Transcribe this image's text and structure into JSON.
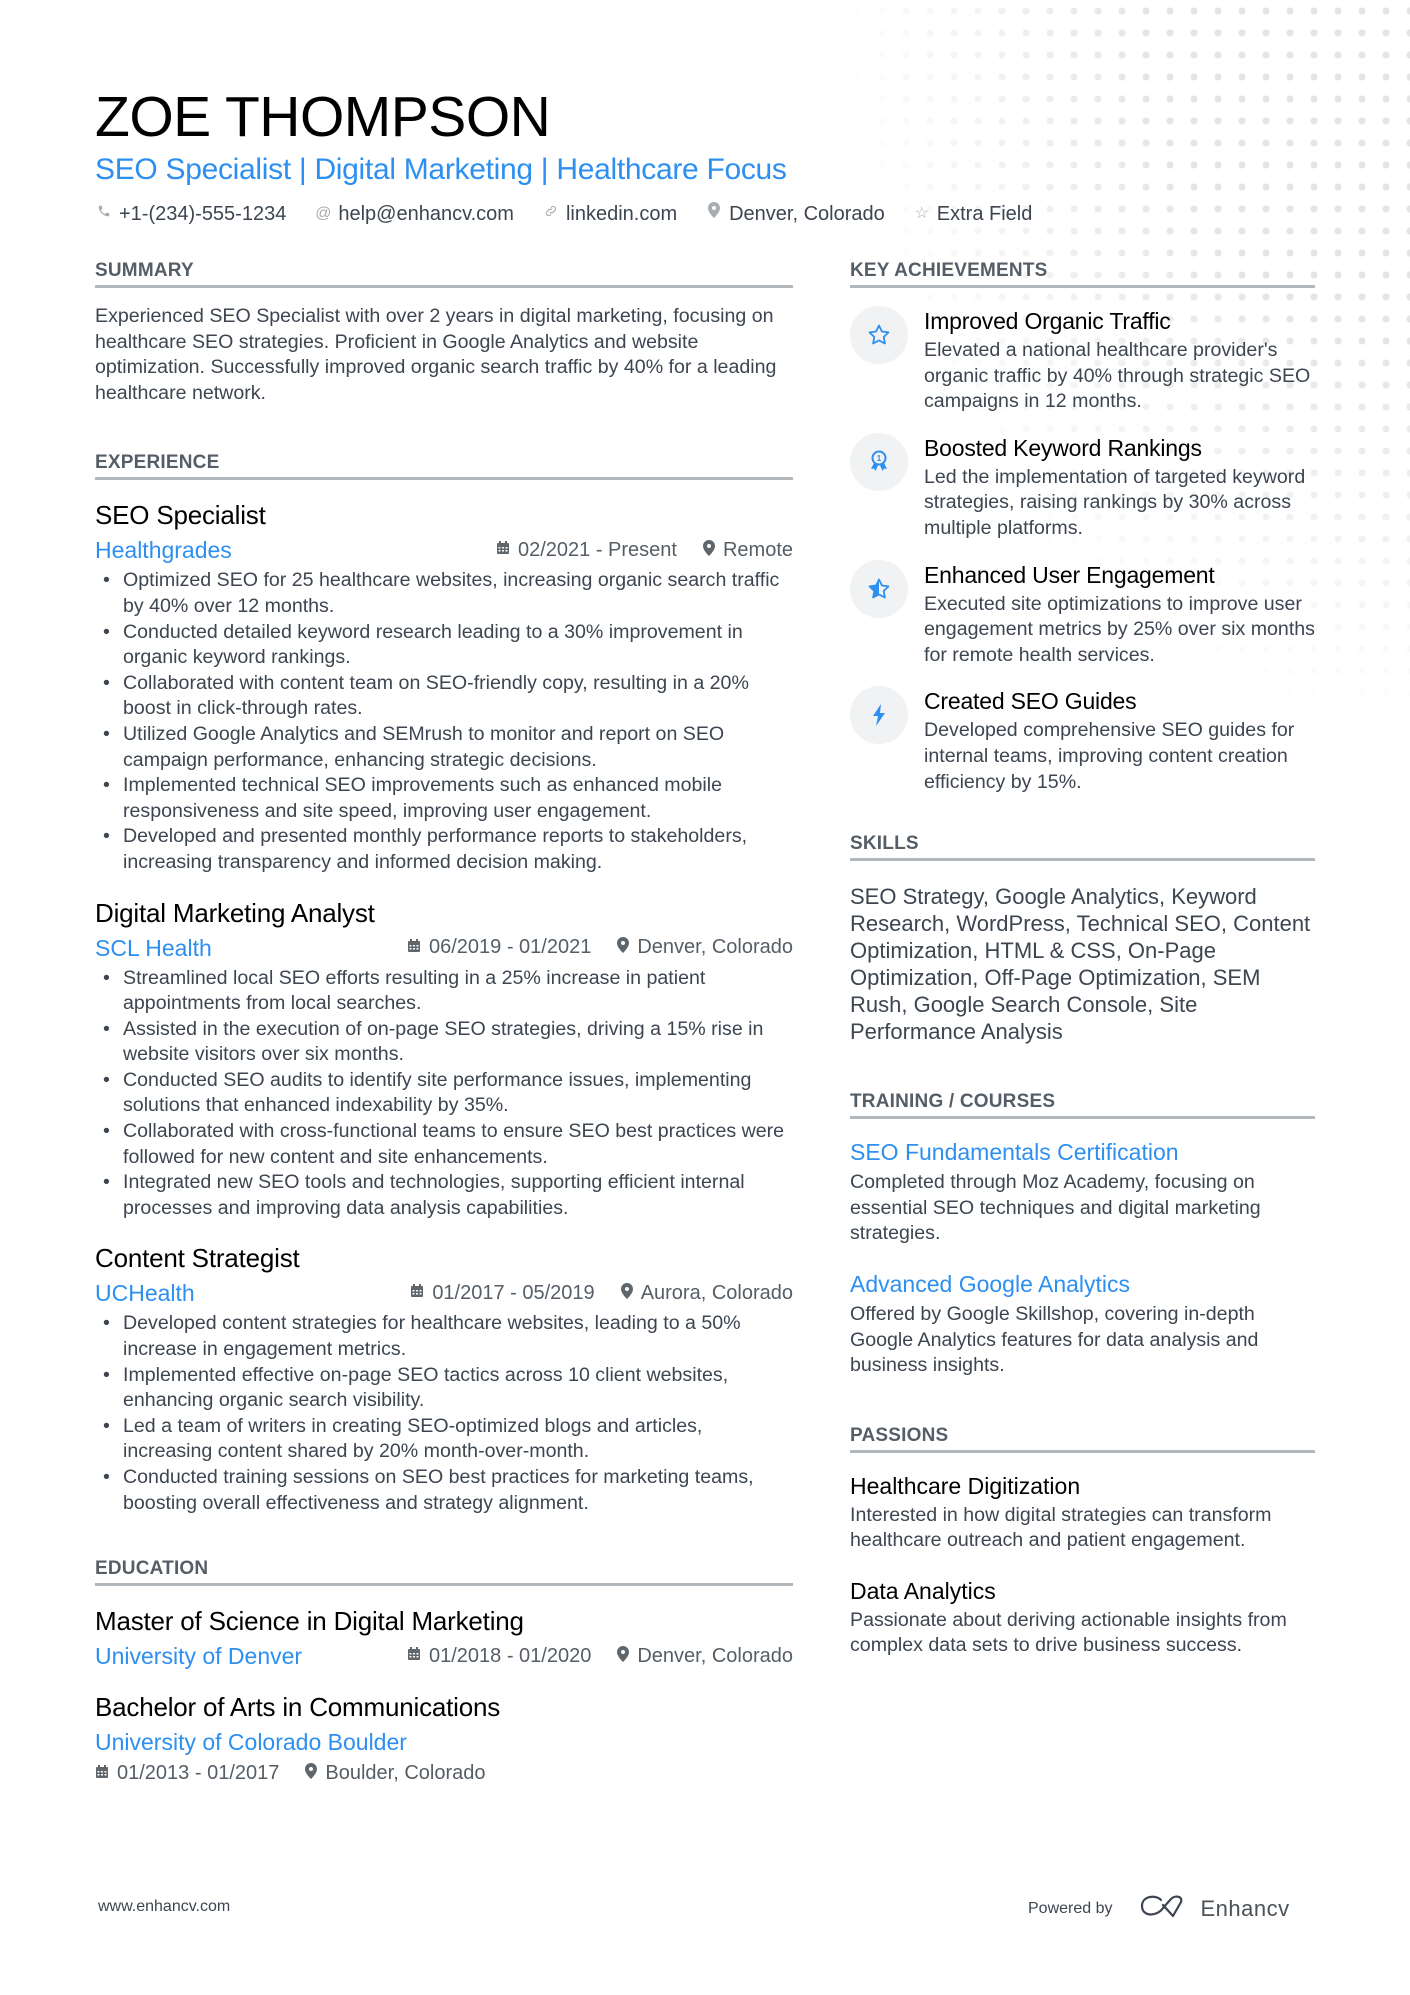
{
  "header": {
    "name": "ZOE THOMPSON",
    "title": "SEO Specialist | Digital Marketing | Healthcare Focus",
    "contacts": [
      {
        "icon": "phone-icon",
        "text": "+1-(234)-555-1234"
      },
      {
        "icon": "at-icon",
        "text": "help@enhancv.com"
      },
      {
        "icon": "link-icon",
        "text": "linkedin.com"
      },
      {
        "icon": "location-pin-icon",
        "text": "Denver, Colorado"
      },
      {
        "icon": "star-outline-icon",
        "text": "Extra Field"
      }
    ]
  },
  "summary": {
    "heading": "SUMMARY",
    "text": "Experienced SEO Specialist with over 2 years in digital marketing, focusing on healthcare SEO strategies. Proficient in Google Analytics and website optimization. Successfully improved organic search traffic by 40% for a leading healthcare network."
  },
  "experience": {
    "heading": "EXPERIENCE",
    "jobs": [
      {
        "title": "SEO Specialist",
        "company": "Healthgrades",
        "dates": "02/2021 - Present",
        "location": "Remote",
        "bullets": [
          "Optimized SEO for 25 healthcare websites, increasing organic search traffic by 40% over 12 months.",
          "Conducted detailed keyword research leading to a 30% improvement in organic keyword rankings.",
          "Collaborated with content team on SEO-friendly copy, resulting in a 20% boost in click-through rates.",
          "Utilized Google Analytics and SEMrush to monitor and report on SEO campaign performance, enhancing strategic decisions.",
          "Implemented technical SEO improvements such as enhanced mobile responsiveness and site speed, improving user engagement.",
          "Developed and presented monthly performance reports to stakeholders, increasing transparency and informed decision making."
        ]
      },
      {
        "title": "Digital Marketing Analyst",
        "company": "SCL Health",
        "dates": "06/2019 - 01/2021",
        "location": "Denver, Colorado",
        "bullets": [
          "Streamlined local SEO efforts resulting in a 25% increase in patient appointments from local searches.",
          "Assisted in the execution of on-page SEO strategies, driving a 15% rise in website visitors over six months.",
          "Conducted SEO audits to identify site performance issues, implementing solutions that enhanced indexability by 35%.",
          "Collaborated with cross-functional teams to ensure SEO best practices were followed for new content and site enhancements.",
          "Integrated new SEO tools and technologies, supporting efficient internal processes and improving data analysis capabilities."
        ]
      },
      {
        "title": "Content Strategist",
        "company": "UCHealth",
        "dates": "01/2017 - 05/2019",
        "location": "Aurora, Colorado",
        "bullets": [
          "Developed content strategies for healthcare websites, leading to a 50% increase in engagement metrics.",
          "Implemented effective on-page SEO tactics across 10 client websites, enhancing organic search visibility.",
          "Led a team of writers in creating SEO-optimized blogs and articles, increasing content shared by 20% month-over-month.",
          "Conducted training sessions on SEO best practices for marketing teams, boosting overall effectiveness and strategy alignment."
        ]
      }
    ]
  },
  "education": {
    "heading": "EDUCATION",
    "items": [
      {
        "degree": "Master of Science in Digital Marketing",
        "school": "University of Denver",
        "dates": "01/2018 - 01/2020",
        "location": "Denver, Colorado"
      },
      {
        "degree": "Bachelor of Arts in Communications",
        "school": "University of Colorado Boulder",
        "dates": "01/2013 - 01/2017",
        "location": "Boulder, Colorado"
      }
    ]
  },
  "achievements": {
    "heading": "KEY ACHIEVEMENTS",
    "items": [
      {
        "icon": "star-outline-icon",
        "title": "Improved Organic Traffic",
        "desc": "Elevated a national healthcare provider's organic traffic by 40% through strategic SEO campaigns in 12 months."
      },
      {
        "icon": "award-ribbon-icon",
        "title": "Boosted Keyword Rankings",
        "desc": "Led the implementation of targeted keyword strategies, raising rankings by 30% across multiple platforms."
      },
      {
        "icon": "half-star-icon",
        "title": "Enhanced User Engagement",
        "desc": "Executed site optimizations to improve user engagement metrics by 25% over six months for remote health services."
      },
      {
        "icon": "lightning-bolt-icon",
        "title": "Created SEO Guides",
        "desc": "Developed comprehensive SEO guides for internal teams, improving content creation efficiency by 15%."
      }
    ]
  },
  "skills": {
    "heading": "SKILLS",
    "text": "SEO Strategy, Google Analytics, Keyword Research, WordPress, Technical SEO, Content Optimization, HTML & CSS, On-Page Optimization, Off-Page Optimization, SEM Rush, Google Search Console, Site Performance Analysis"
  },
  "training": {
    "heading": "TRAINING / COURSES",
    "items": [
      {
        "title": "SEO Fundamentals Certification",
        "desc": "Completed through Moz Academy, focusing on essential SEO techniques and digital marketing strategies."
      },
      {
        "title": "Advanced Google Analytics",
        "desc": "Offered by Google Skillshop, covering in-depth Google Analytics features for data analysis and business insights."
      }
    ]
  },
  "passions": {
    "heading": "PASSIONS",
    "items": [
      {
        "title": "Healthcare Digitization",
        "desc": "Interested in how digital strategies can transform healthcare outreach and patient engagement."
      },
      {
        "title": "Data Analytics",
        "desc": "Passionate about deriving actionable insights from complex data sets to drive business success."
      }
    ]
  },
  "footer": {
    "website": "www.enhancv.com",
    "powered_by": "Powered by",
    "brand": "Enhancv"
  },
  "colors": {
    "accent": "#2d8ff0",
    "text": "#3c4550",
    "heading_rule": "#b2b7bb",
    "icon_bg": "#f1f2f3"
  }
}
